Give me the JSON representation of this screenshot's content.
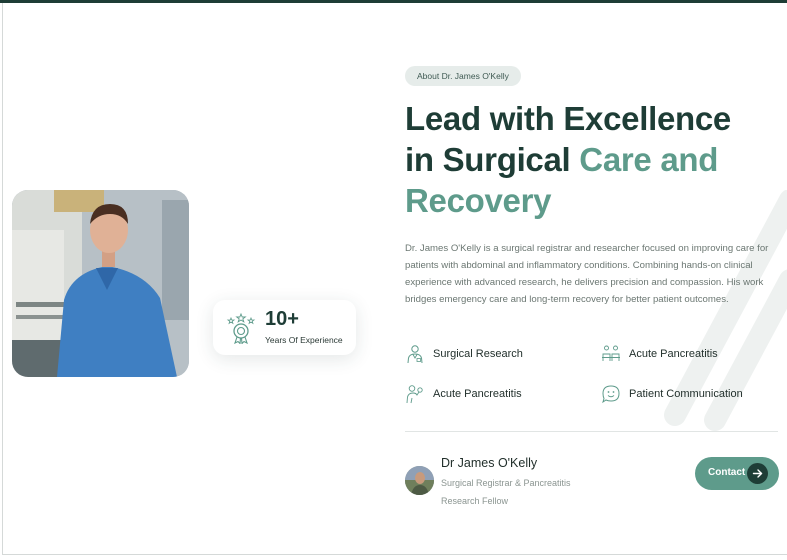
{
  "about_badge": "About Dr. James O'Kelly",
  "headline": {
    "line1": "Lead with Excellence",
    "line2_dark": "in Surgical ",
    "line2_accent": "Care and",
    "line3_accent": "Recovery"
  },
  "bio": "Dr. James O'Kelly is a surgical registrar and researcher focused on improving care for patients with abdominal and inflammatory conditions. Combining hands-on clinical experience with advanced research, he delivers precision and compassion. His work bridges emergency care and long-term recovery for better patient outcomes.",
  "experience": {
    "number": "10+",
    "label": "Years Of Experience",
    "icon": "medal-icon"
  },
  "features": [
    {
      "label": "Surgical Research",
      "icon": "researcher-icon"
    },
    {
      "label": "Acute Pancreatitis",
      "icon": "ward-icon"
    },
    {
      "label": "Acute Pancreatitis",
      "icon": "consult-icon"
    },
    {
      "label": "Patient Communication",
      "icon": "speech-face-icon"
    }
  ],
  "author": {
    "name": "Dr James O'Kelly",
    "role": "Surgical Registrar & Pancreatitis Research Fellow"
  },
  "contact_button": {
    "label": "Contact",
    "icon": "arrow-right-icon"
  },
  "colors": {
    "brand_dark": "#1e3d36",
    "accent": "#5e9b8b",
    "pill_bg": "#e6ecea"
  }
}
